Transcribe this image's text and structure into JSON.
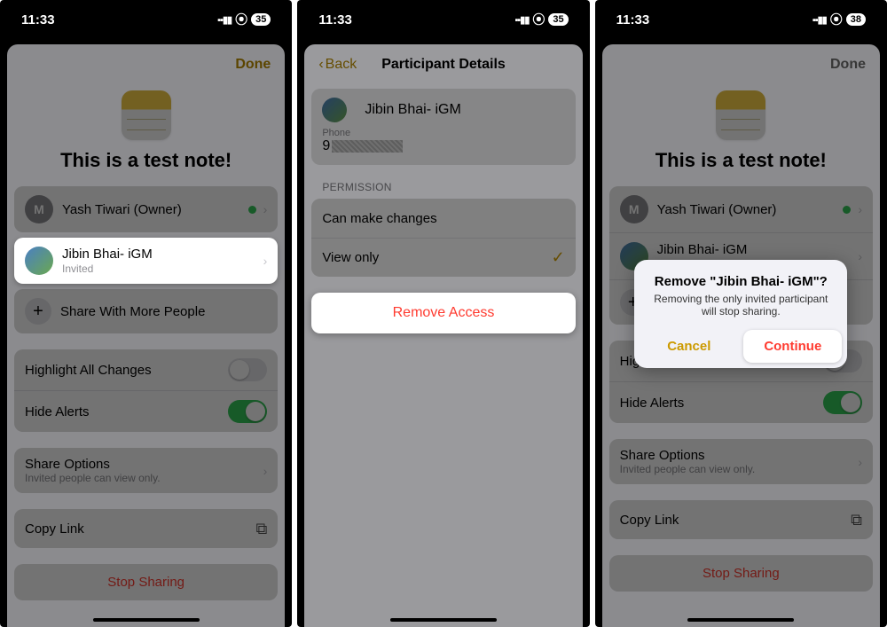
{
  "status": {
    "time": "11:33",
    "battery": "35",
    "battery3": "38"
  },
  "screen1": {
    "done": "Done",
    "title": "This is a test note!",
    "owner": {
      "initial": "M",
      "name": "Yash Tiwari (Owner)"
    },
    "invitee": {
      "name": "Jibin Bhai- iGM",
      "status": "Invited"
    },
    "shareMore": "Share With More People",
    "highlight": "Highlight All Changes",
    "hideAlerts": "Hide Alerts",
    "shareOptions": "Share Options",
    "shareOptionsSub": "Invited people can view only.",
    "copyLink": "Copy Link",
    "stopSharing": "Stop Sharing"
  },
  "screen2": {
    "back": "Back",
    "title": "Participant Details",
    "name": "Jibin Bhai- iGM",
    "phoneLabel": "Phone",
    "phonePrefix": "9",
    "permissionHeader": "PERMISSION",
    "canMake": "Can make changes",
    "viewOnly": "View only",
    "remove": "Remove Access"
  },
  "screen3": {
    "done": "Done",
    "alertTitle": "Remove \"Jibin Bhai- iGM\"?",
    "alertMsg": "Removing the only invited participant will stop sharing.",
    "cancel": "Cancel",
    "continue": "Continue"
  }
}
